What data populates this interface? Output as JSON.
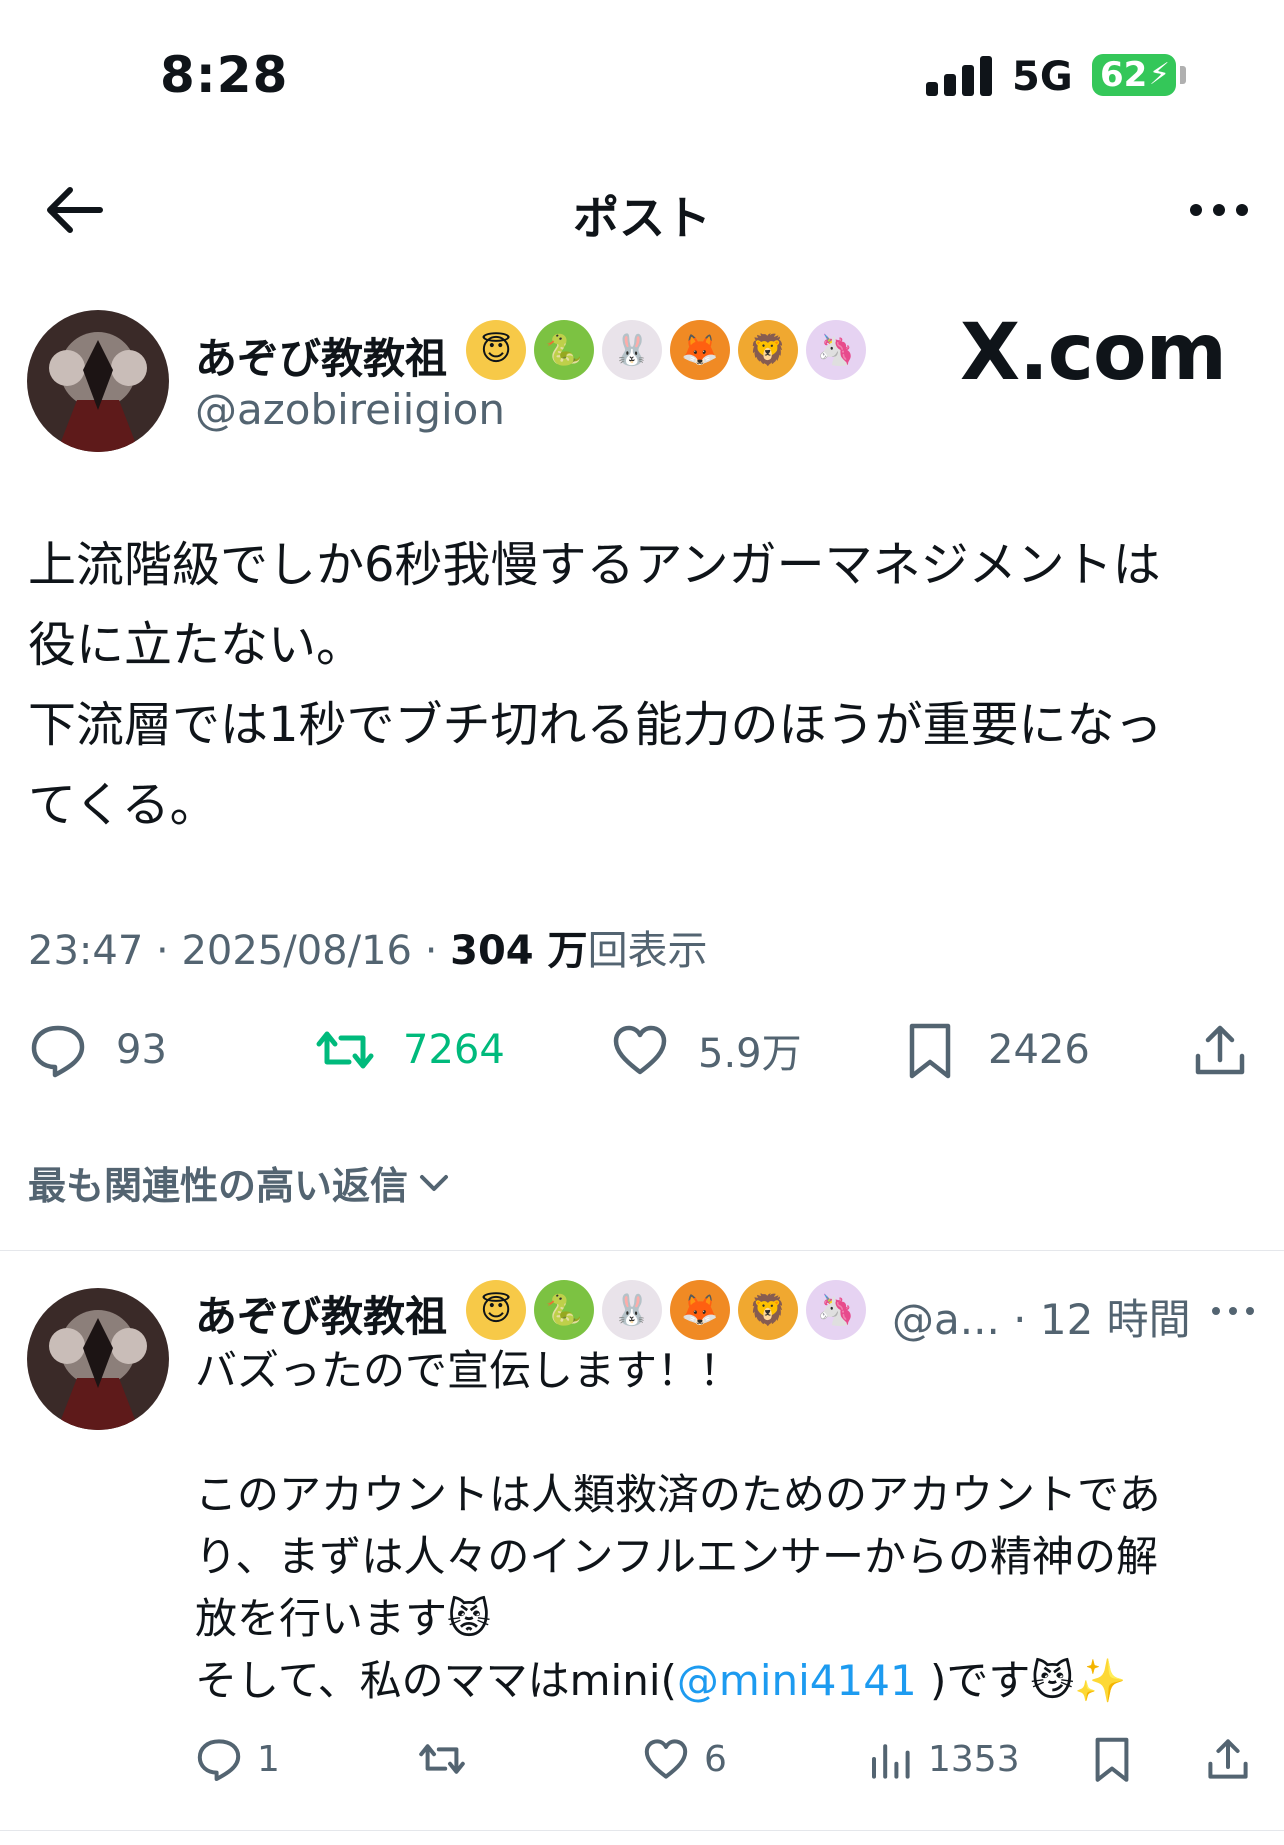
{
  "status_bar": {
    "time": "8:28",
    "network": "5G",
    "battery": "62"
  },
  "header": {
    "title": "ポスト"
  },
  "post": {
    "author_name": "あぞび教教祖",
    "author_emojis": [
      {
        "name": "halo-face-emoji",
        "glyph": "😇",
        "bg": "#f7c948"
      },
      {
        "name": "snake-emoji",
        "glyph": "🐍",
        "bg": "#7cc242"
      },
      {
        "name": "rabbit-emoji",
        "glyph": "🐰",
        "bg": "#e9e3ea"
      },
      {
        "name": "fox-emoji",
        "glyph": "🦊",
        "bg": "#f08a24"
      },
      {
        "name": "lion-emoji",
        "glyph": "🦁",
        "bg": "#f0a830"
      },
      {
        "name": "unicorn-emoji",
        "glyph": "🦄",
        "bg": "#e6d3f2"
      }
    ],
    "handle": "@azobireiigion",
    "watermark": "X.com",
    "text": "上流階級でしか6秒我慢するアンガーマネジメントは\n役に立たない。\n下流層では1秒でブチ切れる能力のほうが重要になっ\nてくる。",
    "time": "23:47",
    "date": "2025/08/16",
    "views": "304 万",
    "views_label": "回表示",
    "replies": "93",
    "reposts": "7264",
    "likes": "5.9万",
    "bookmarks": "2426"
  },
  "sort_label": "最も関連性の高い返信",
  "reply": {
    "author_name": "あぞび教教祖",
    "handle_short": "@a...",
    "age": "12 時間",
    "text_before": "バズったので宣伝します！！\n\nこのアカウントは人類救済のためのアカウントであ\nり、まずは人々のインフルエンサーからの精神の解\n放を行います😾\nそして、私のママはmini(",
    "mention": "@mini4141",
    "text_after": " )です😼✨",
    "replies": "1",
    "likes": "6",
    "views": "1353"
  },
  "colors": {
    "accent": "#1d9bf0",
    "repost_green": "#00ba7c",
    "muted": "#536471"
  }
}
